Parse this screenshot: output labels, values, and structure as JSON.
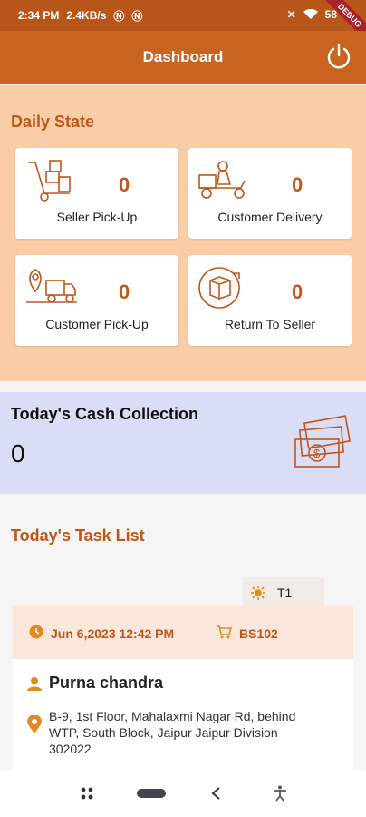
{
  "status": {
    "time": "2:34 PM",
    "speed": "2.4KB/s",
    "battery": "58",
    "debug_label": "DEBUG"
  },
  "appbar": {
    "title": "Dashboard",
    "power_icon": "power-icon"
  },
  "daily_state": {
    "title": "Daily State",
    "cards": [
      {
        "label": "Seller Pick-Up",
        "count": "0",
        "icon": "hand-truck-icon"
      },
      {
        "label": "Customer Delivery",
        "count": "0",
        "icon": "delivery-scooter-icon"
      },
      {
        "label": "Customer Pick-Up",
        "count": "0",
        "icon": "location-truck-icon"
      },
      {
        "label": "Return To Seller",
        "count": "0",
        "icon": "return-box-icon"
      }
    ]
  },
  "cash_collection": {
    "title": "Today's Cash Collection",
    "amount": "0",
    "icon": "cash-stack-icon"
  },
  "task_list": {
    "title": "Today's Task List",
    "tab_label": "T1",
    "tab_icon": "sun-icon",
    "task": {
      "date": "Jun 6,2023 12:42 PM",
      "code": "BS102",
      "name": "Purna chandra",
      "address": "B-9, 1st Floor, Mahalaxmi Nagar Rd, behind WTP, South Block,   Jaipur Jaipur Division 302022"
    }
  },
  "colors": {
    "primary": "#c8641f",
    "accent": "#c0561a",
    "daily_bg": "#f9cda6",
    "cash_bg": "#d9def6"
  }
}
